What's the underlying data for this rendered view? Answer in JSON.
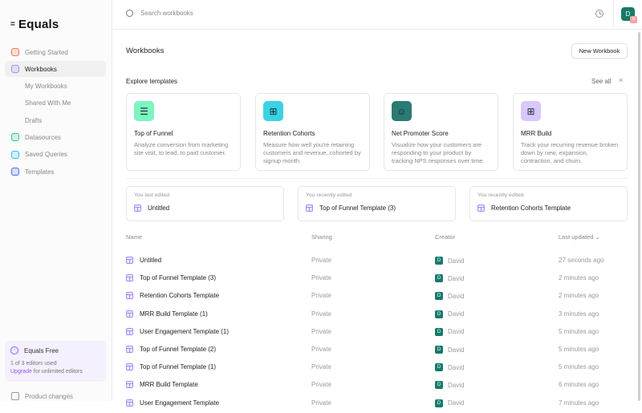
{
  "app": {
    "logo": "Equals"
  },
  "sidebar": {
    "items": [
      {
        "label": "Getting Started",
        "color": "#f97352"
      },
      {
        "label": "Workbooks",
        "color": "#a78bfa",
        "active": true
      },
      {
        "label": "My Workbooks",
        "sub": true
      },
      {
        "label": "Shared With Me",
        "sub": true
      },
      {
        "label": "Drafts",
        "sub": true
      },
      {
        "label": "Datasources",
        "color": "#34c38f"
      },
      {
        "label": "Saved Queries",
        "color": "#38bdf8"
      },
      {
        "label": "Templates",
        "color": "#4f6bf0"
      }
    ],
    "plan": {
      "title": "Equals Free",
      "usage": "1 of 3 editors used",
      "upgrade": "Upgrade",
      "upgrade_rest": " for unlimited editors"
    },
    "product_changes": "Product changes"
  },
  "topbar": {
    "search_placeholder": "Search workbooks",
    "avatar": "D",
    "badge": "8"
  },
  "main": {
    "title": "Workbooks",
    "new_button": "New Workbook",
    "explore": "Explore templates",
    "see_all": "See all",
    "close": "×",
    "templates": [
      {
        "title": "Top of Funnel",
        "desc": "Analyze conversion from marketing site visit, to lead, to paid customer.",
        "icon": "funnel-icon",
        "glyph": "☰",
        "color": "#7cf5c0"
      },
      {
        "title": "Retention Cohorts",
        "desc": "Measure how well you're retaining customers and revenue, cohorted by signup month.",
        "icon": "cohorts-icon",
        "glyph": "⊞",
        "color": "#3bd3e3"
      },
      {
        "title": "Net Promoter Score",
        "desc": "Visualize how your customers are responding to your product by tracking NPS responses over time.",
        "icon": "smiley-icon",
        "glyph": "☺",
        "color": "#2b7a73"
      },
      {
        "title": "MRR Build",
        "desc": "Track your recurring revenue broken down by new, expansion, contraction, and churn.",
        "icon": "grid-icon",
        "glyph": "⊞",
        "color": "#d9c8fb"
      }
    ],
    "recent": [
      {
        "label": "You last edited",
        "name": "Untitled"
      },
      {
        "label": "You recently edited",
        "name": "Top of Funnel Template (3)"
      },
      {
        "label": "You recently edited",
        "name": "Retention Cohorts Template"
      }
    ],
    "table": {
      "headers": [
        "Name",
        "Sharing",
        "Creator",
        "Last updated ⌄"
      ],
      "rows": [
        {
          "name": "Untitled",
          "sharing": "Private",
          "creator": "David",
          "initial": "D",
          "updated": "27 seconds ago"
        },
        {
          "name": "Top of Funnel Template (3)",
          "sharing": "Private",
          "creator": "David",
          "initial": "D",
          "updated": "2 minutes ago"
        },
        {
          "name": "Retention Cohorts Template",
          "sharing": "Private",
          "creator": "David",
          "initial": "D",
          "updated": "2 minutes ago"
        },
        {
          "name": "MRR Build Template (1)",
          "sharing": "Private",
          "creator": "David",
          "initial": "D",
          "updated": "3 minutes ago"
        },
        {
          "name": "User Engagement Template (1)",
          "sharing": "Private",
          "creator": "David",
          "initial": "D",
          "updated": "5 minutes ago"
        },
        {
          "name": "Top of Funnel Template (2)",
          "sharing": "Private",
          "creator": "David",
          "initial": "D",
          "updated": "5 minutes ago"
        },
        {
          "name": "Top of Funnel Template (1)",
          "sharing": "Private",
          "creator": "David",
          "initial": "D",
          "updated": "5 minutes ago"
        },
        {
          "name": "MRR Build Template",
          "sharing": "Private",
          "creator": "David",
          "initial": "D",
          "updated": "6 minutes ago"
        },
        {
          "name": "User Engagement Template",
          "sharing": "Private",
          "creator": "David",
          "initial": "D",
          "updated": "7 minutes ago"
        }
      ]
    }
  }
}
